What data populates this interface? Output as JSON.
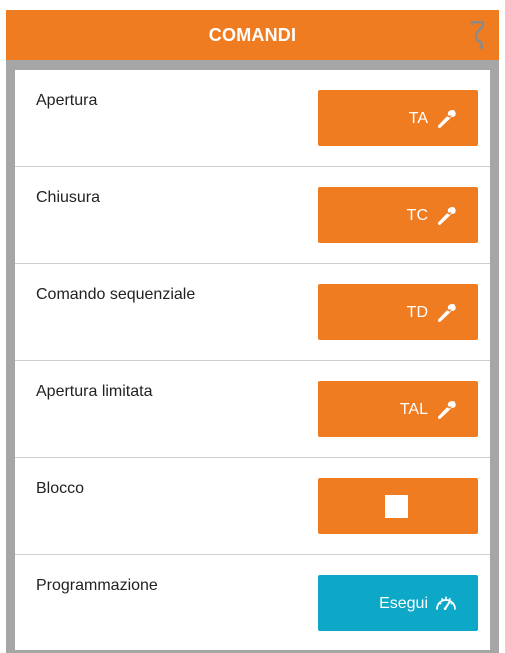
{
  "header": {
    "title": "COMANDI",
    "icon": "hook-icon",
    "color": "#f07c22"
  },
  "commands": [
    {
      "label": "Apertura",
      "button_text": "TA",
      "icon": "wrench-icon",
      "color": "#f07c22"
    },
    {
      "label": "Chiusura",
      "button_text": "TC",
      "icon": "wrench-icon",
      "color": "#f07c22"
    },
    {
      "label": "Comando sequenziale",
      "button_text": "TD",
      "icon": "wrench-icon",
      "color": "#f07c22"
    },
    {
      "label": "Apertura limitata",
      "button_text": "TAL",
      "icon": "wrench-icon",
      "color": "#f07c22"
    },
    {
      "label": "Blocco",
      "button_text": "",
      "icon": "stop-icon",
      "color": "#f07c22"
    },
    {
      "label": "Programmazione",
      "button_text": "Esegui",
      "icon": "speedometer-icon",
      "color": "#0da8c8"
    }
  ]
}
